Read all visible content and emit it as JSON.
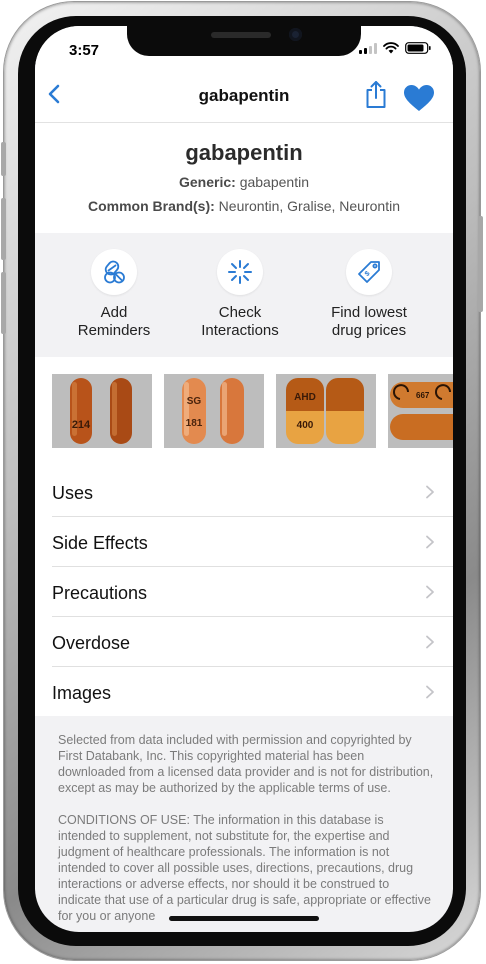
{
  "status_bar": {
    "time": "3:57"
  },
  "nav": {
    "title": "gabapentin",
    "back_icon": "chevron-left-icon",
    "share_icon": "share-icon",
    "favorite_icon": "heart-icon",
    "accent_color": "#2a7bd4"
  },
  "drug": {
    "name": "gabapentin",
    "generic_label": "Generic:",
    "generic_value": "gabapentin",
    "brands_label": "Common Brand(s):",
    "brands_value": "Neurontin, Gralise, Neurontin"
  },
  "actions": [
    {
      "label_line1": "Add",
      "label_line2": "Reminders",
      "icon": "pills-icon"
    },
    {
      "label_line1": "Check",
      "label_line2": "Interactions",
      "icon": "interaction-spark-icon"
    },
    {
      "label_line1": "Find lowest",
      "label_line2": "drug prices",
      "icon": "price-tag-icon"
    }
  ],
  "pill_images": [
    {
      "imprint_top": "",
      "imprint_bottom": "214",
      "colors": [
        "#b8531a",
        "#a94a15"
      ]
    },
    {
      "imprint_top": "SG",
      "imprint_bottom": "181",
      "colors": [
        "#e38a4f",
        "#d8773c"
      ]
    },
    {
      "imprint_top": "AHD",
      "imprint_bottom": "400",
      "colors": [
        "#b55a16",
        "#e8a342"
      ]
    },
    {
      "imprint_top": "667",
      "imprint_bottom": "",
      "colors": [
        "#d07a2f",
        "#c96d22"
      ]
    }
  ],
  "menu": [
    {
      "label": "Uses"
    },
    {
      "label": "Side Effects"
    },
    {
      "label": "Precautions"
    },
    {
      "label": "Overdose"
    },
    {
      "label": "Images"
    }
  ],
  "footer": {
    "copyright": "Selected from data included with permission and copyrighted by First Databank, Inc. This copyrighted material has been downloaded from a licensed data provider and is not for distribution, except as may be authorized by the applicable terms of use.",
    "conditions": "CONDITIONS OF USE: The information in this database is intended to supplement, not substitute for, the expertise and judgment of healthcare professionals. The information is not intended to cover all possible uses, directions, precautions, drug interactions or adverse effects, nor should it be construed to indicate that use of a particular drug is safe, appropriate or effective for you or anyone"
  }
}
